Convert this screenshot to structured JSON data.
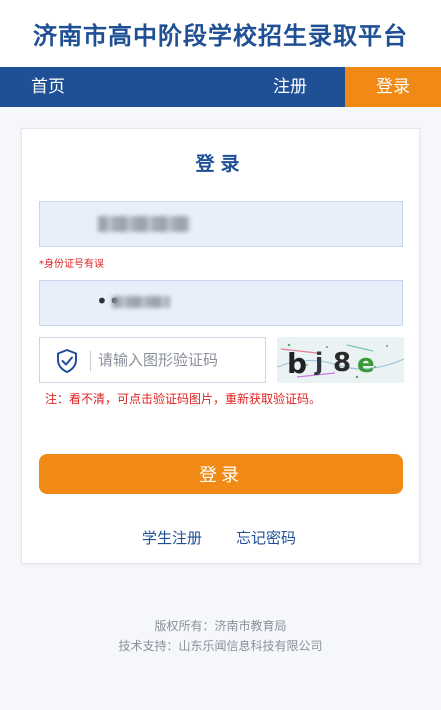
{
  "header": {
    "title": "济南市高中阶段学校招生录取平台"
  },
  "nav": {
    "home": "首页",
    "register": "注册",
    "login": "登录"
  },
  "form": {
    "title": "登录",
    "id_error": "*身份证号有误",
    "captcha_placeholder": "请输入图形验证码",
    "captcha_text": "bj8e",
    "captcha_note": "注：看不清，可点击验证码图片，重新获取验证码。",
    "login_button": "登录",
    "student_register": "学生注册",
    "forgot_password": "忘记密码"
  },
  "footer": {
    "copyright": "版权所有：济南市教育局",
    "support": "技术支持：山东乐闻信息科技有限公司"
  },
  "colors": {
    "brand_blue": "#1f4f95",
    "accent_orange": "#f08a15",
    "error_red": "#e02020"
  },
  "icons": {
    "captcha_field": "shield-check-icon"
  }
}
